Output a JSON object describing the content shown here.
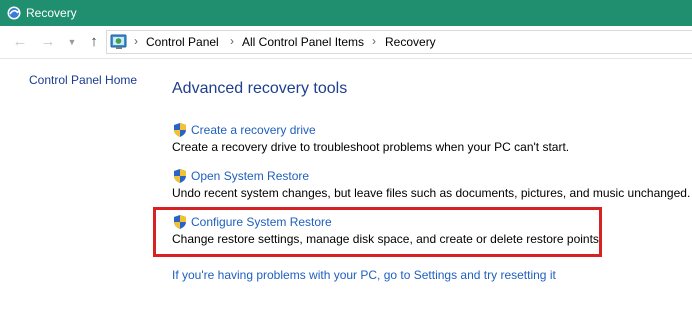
{
  "window": {
    "title": "Recovery"
  },
  "nav": {
    "back_icon": "arrow-left-icon",
    "forward_icon": "arrow-right-icon",
    "up_icon": "arrow-up-icon",
    "breadcrumb": [
      "Control Panel",
      "All Control Panel Items",
      "Recovery"
    ]
  },
  "sidebar": {
    "home_link": "Control Panel Home"
  },
  "main": {
    "heading": "Advanced recovery tools",
    "tasks": [
      {
        "label": "Create a recovery drive",
        "description": "Create a recovery drive to troubleshoot problems when your PC can't start.",
        "icon": "uac-shield-icon"
      },
      {
        "label": "Open System Restore",
        "description": "Undo recent system changes, but leave files such as documents, pictures, and music unchanged.",
        "icon": "uac-shield-icon"
      },
      {
        "label": "Configure System Restore",
        "description": "Change restore settings, manage disk space, and create or delete restore points.",
        "icon": "uac-shield-icon",
        "highlighted": true
      }
    ],
    "reset_link": "If you're having problems with your PC, go to Settings and try resetting it"
  },
  "colors": {
    "titlebar": "#1f8f6f",
    "link": "#1f5fbf",
    "heading": "#1e3f8f",
    "highlight_border": "#d62222"
  }
}
